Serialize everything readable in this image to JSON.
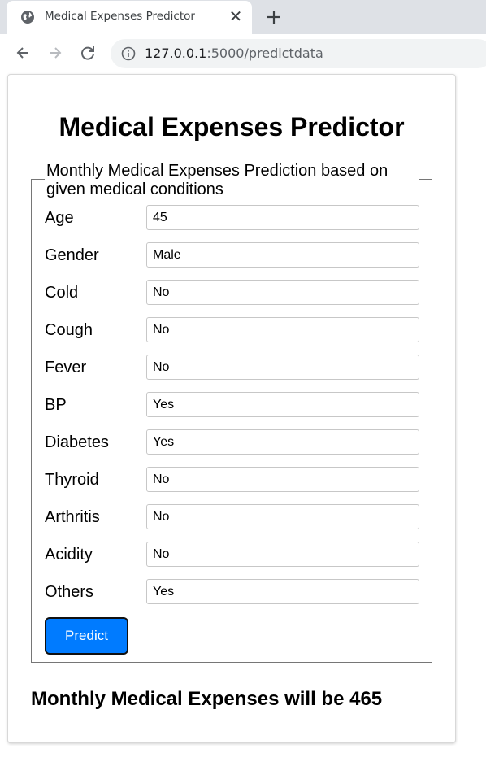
{
  "browser": {
    "tab_title": "Medical Expenses Predictor",
    "tab_close": "✕",
    "url_host": "127.0.0.1",
    "url_path": ":5000/predictdata"
  },
  "page": {
    "title": "Medical Expenses Predictor",
    "legend": "Monthly Medical Expenses Prediction based on given medical conditions",
    "fields": [
      {
        "label": "Age",
        "value": "45"
      },
      {
        "label": "Gender",
        "value": "Male"
      },
      {
        "label": "Cold",
        "value": "No"
      },
      {
        "label": "Cough",
        "value": "No"
      },
      {
        "label": "Fever",
        "value": "No"
      },
      {
        "label": "BP",
        "value": "Yes"
      },
      {
        "label": "Diabetes",
        "value": "Yes"
      },
      {
        "label": "Thyroid",
        "value": "No"
      },
      {
        "label": "Arthritis",
        "value": "No"
      },
      {
        "label": "Acidity",
        "value": "No"
      },
      {
        "label": "Others",
        "value": "Yes"
      }
    ],
    "predict_label": "Predict",
    "result_text": "Monthly Medical Expenses will be 465"
  },
  "colors": {
    "button_bg": "#007bff",
    "tabstrip_bg": "#dee1e6",
    "omnibox_bg": "#f1f3f4"
  }
}
